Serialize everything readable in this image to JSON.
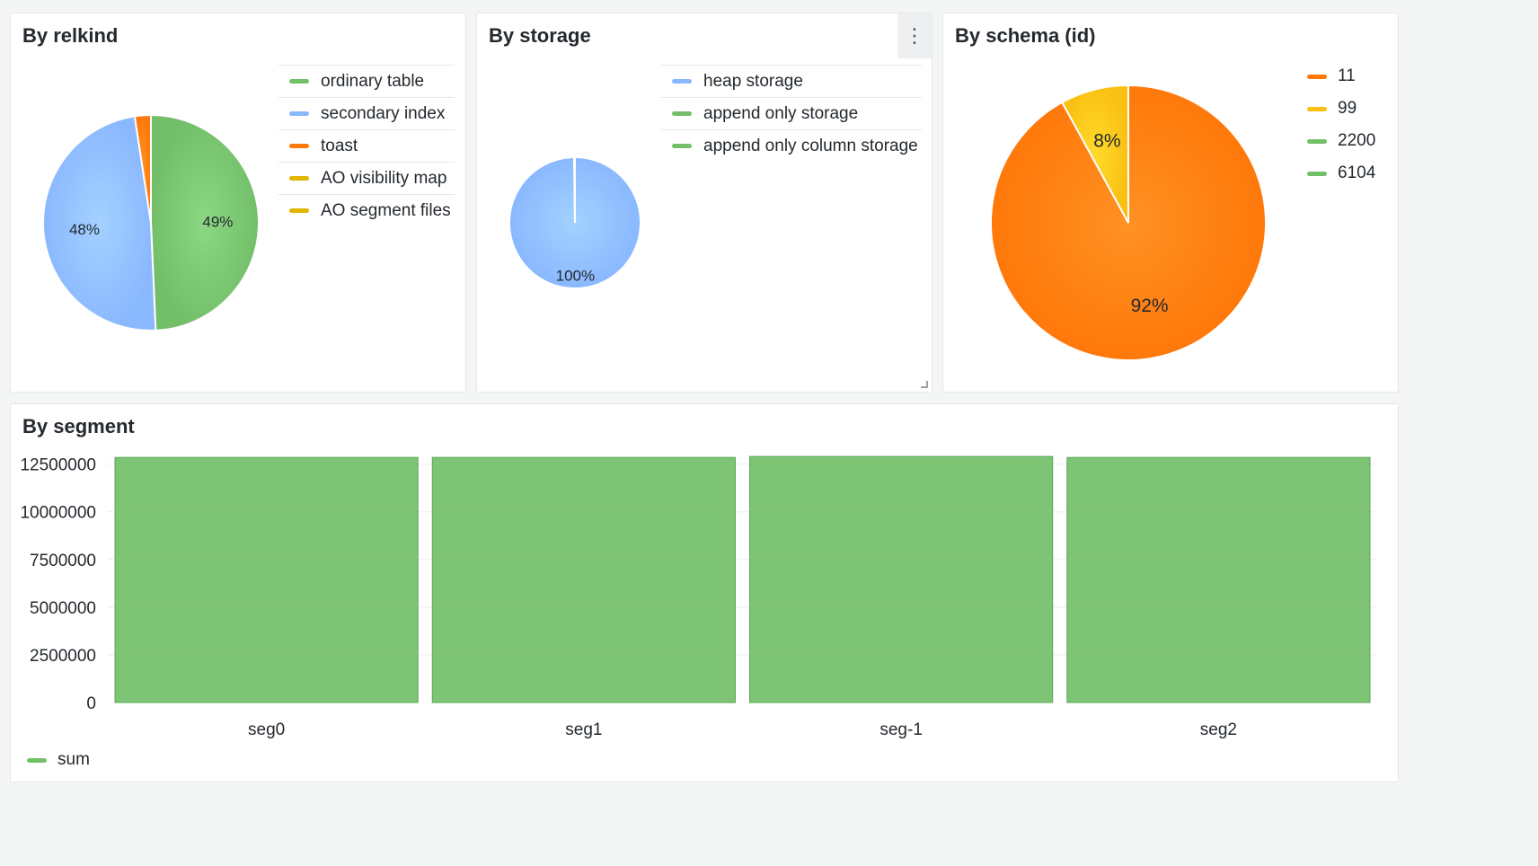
{
  "panels": {
    "relkind": {
      "title": "By relkind"
    },
    "storage": {
      "title": "By storage",
      "menu_icon": "more-vertical-icon"
    },
    "schema": {
      "title": "By schema (id)"
    },
    "segment": {
      "title": "By segment"
    }
  },
  "chart_data": [
    {
      "type": "pie",
      "title": "By relkind",
      "legend_position": "right",
      "slices": [
        {
          "name": "ordinary table",
          "value": 49,
          "color": "#73bf69",
          "label": "49%"
        },
        {
          "name": "secondary index",
          "value": 48,
          "color": "#8ab8ff",
          "label": "48%"
        },
        {
          "name": "toast",
          "value": 2.4,
          "color": "#ff780a",
          "label": ""
        },
        {
          "name": "AO visibility map",
          "value": 0,
          "color": "#e0b400",
          "label": ""
        },
        {
          "name": "AO segment files",
          "value": 0,
          "color": "#e0b400",
          "label": ""
        }
      ]
    },
    {
      "type": "pie",
      "title": "By storage",
      "legend_position": "right",
      "slices": [
        {
          "name": "heap storage",
          "value": 100,
          "color": "#8ab8ff",
          "label": "100%"
        },
        {
          "name": "append only storage",
          "value": 0.2,
          "color": "#73bf69",
          "label": ""
        },
        {
          "name": "append only column storage",
          "value": 0,
          "color": "#73bf69",
          "label": ""
        }
      ]
    },
    {
      "type": "pie",
      "title": "By schema (id)",
      "legend_position": "right",
      "slices": [
        {
          "name": "11",
          "value": 92,
          "color": "#ff780a",
          "label": "92%"
        },
        {
          "name": "99",
          "value": 8,
          "color": "#fac113",
          "label": "8%"
        },
        {
          "name": "2200",
          "value": 0,
          "color": "#73bf69",
          "label": ""
        },
        {
          "name": "6104",
          "value": 0,
          "color": "#73bf69",
          "label": ""
        }
      ]
    },
    {
      "type": "bar",
      "title": "By segment",
      "categories": [
        "seg0",
        "seg1",
        "seg-1",
        "seg2"
      ],
      "series": [
        {
          "name": "sum",
          "values": [
            12850000,
            12850000,
            12900000,
            12850000
          ],
          "color": "#73bf69"
        }
      ],
      "yticks": [
        "0",
        "2500000",
        "5000000",
        "7500000",
        "10000000",
        "12500000"
      ],
      "ylim": [
        0,
        13000000
      ],
      "grid": true,
      "legend_position": "bottom-left"
    }
  ]
}
